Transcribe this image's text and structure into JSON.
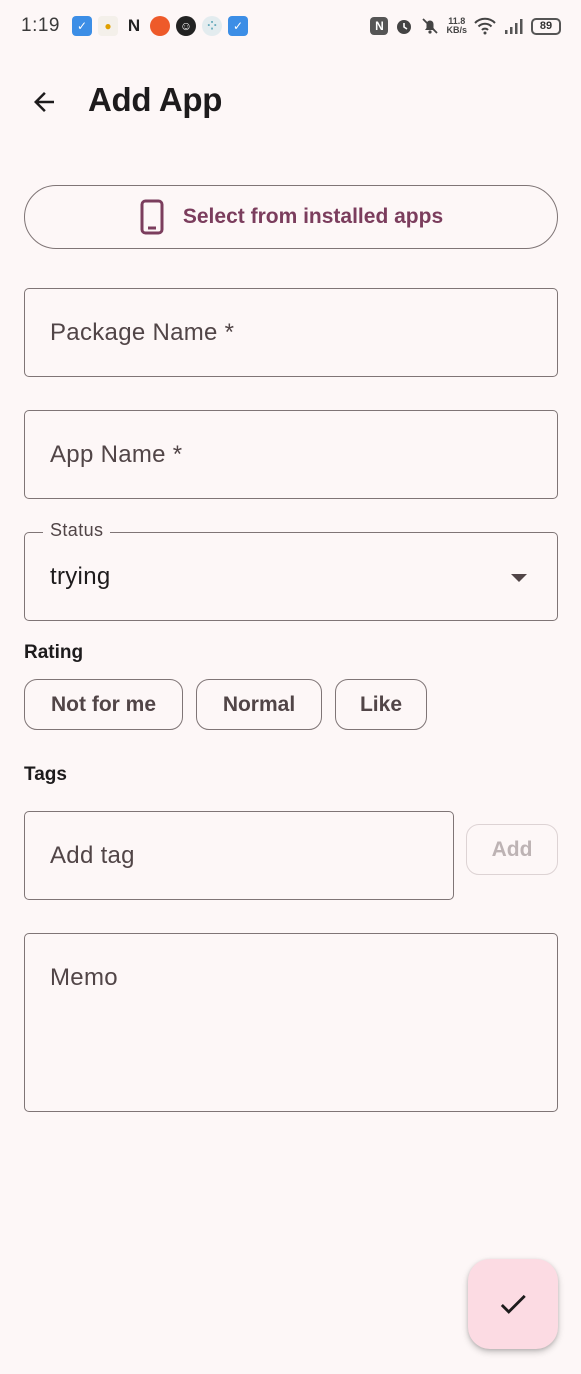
{
  "status_bar": {
    "time": "1:19",
    "net_speed_value": "11.8",
    "net_speed_unit": "KB/s",
    "battery": "89"
  },
  "header": {
    "title": "Add App",
    "back_icon": "arrow-back-icon"
  },
  "select_installed": {
    "label": "Select from installed apps",
    "icon": "smartphone-icon"
  },
  "form": {
    "package_name_placeholder": "Package Name *",
    "app_name_placeholder": "App Name *",
    "status_label": "Status",
    "status_value": "trying",
    "rating_label": "Rating",
    "rating_options": [
      "Not for me",
      "Normal",
      "Like"
    ],
    "tags_label": "Tags",
    "tag_placeholder": "Add tag",
    "add_tag_button": "Add",
    "memo_placeholder": "Memo"
  },
  "fab": {
    "icon": "check-icon"
  },
  "colors": {
    "background": "#fdf7f7",
    "primary": "#7b3d5d",
    "outline": "#7f7576",
    "fab_container": "#fcdbe3"
  }
}
